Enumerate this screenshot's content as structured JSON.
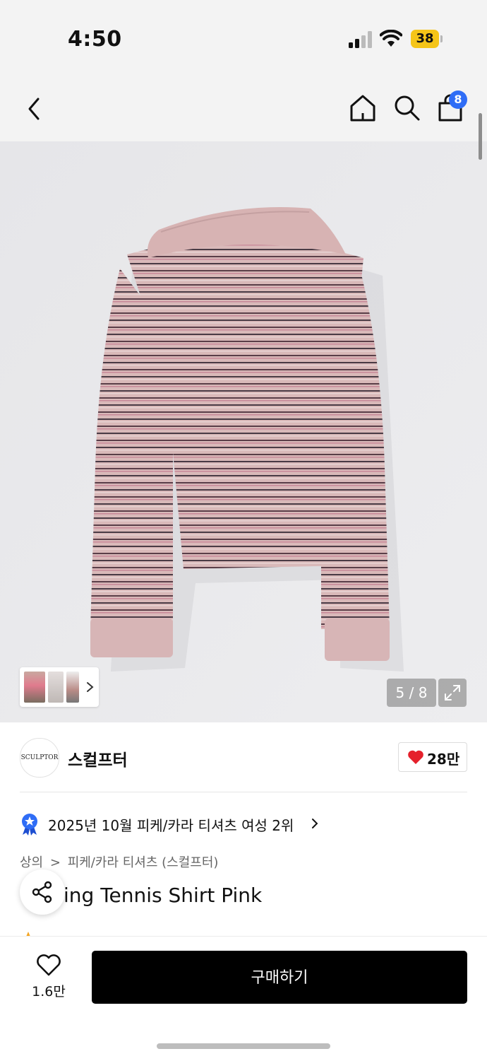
{
  "status_bar": {
    "time": "4:50",
    "battery": "38",
    "battery_color": "#f5c518"
  },
  "nav": {
    "icons": [
      "back-icon",
      "home-icon",
      "search-icon",
      "cart-icon"
    ],
    "cart_badge": "8",
    "badge_color": "#2f6df6"
  },
  "gallery": {
    "counter": "5 / 8",
    "expand_icon": "expand-icon",
    "thumbnail_chevron": "chevron-right-icon"
  },
  "brand": {
    "logo_text": "SCULPTOR",
    "name": "스컬프터",
    "likes": "28만",
    "heart_color": "#e5202b"
  },
  "ranking": {
    "text": "2025년 10월 피케/카라 티셔츠 여성 2위",
    "badge_color": "#2f6df6"
  },
  "breadcrumb": {
    "items": [
      "상의",
      "피케/카라 티셔츠 (스컬프터)"
    ],
    "separator": ">"
  },
  "product": {
    "title_visible": "ing Tennis Shirt Pink"
  },
  "bottom_bar": {
    "wish_count": "1.6만",
    "buy_label": "구매하기"
  }
}
